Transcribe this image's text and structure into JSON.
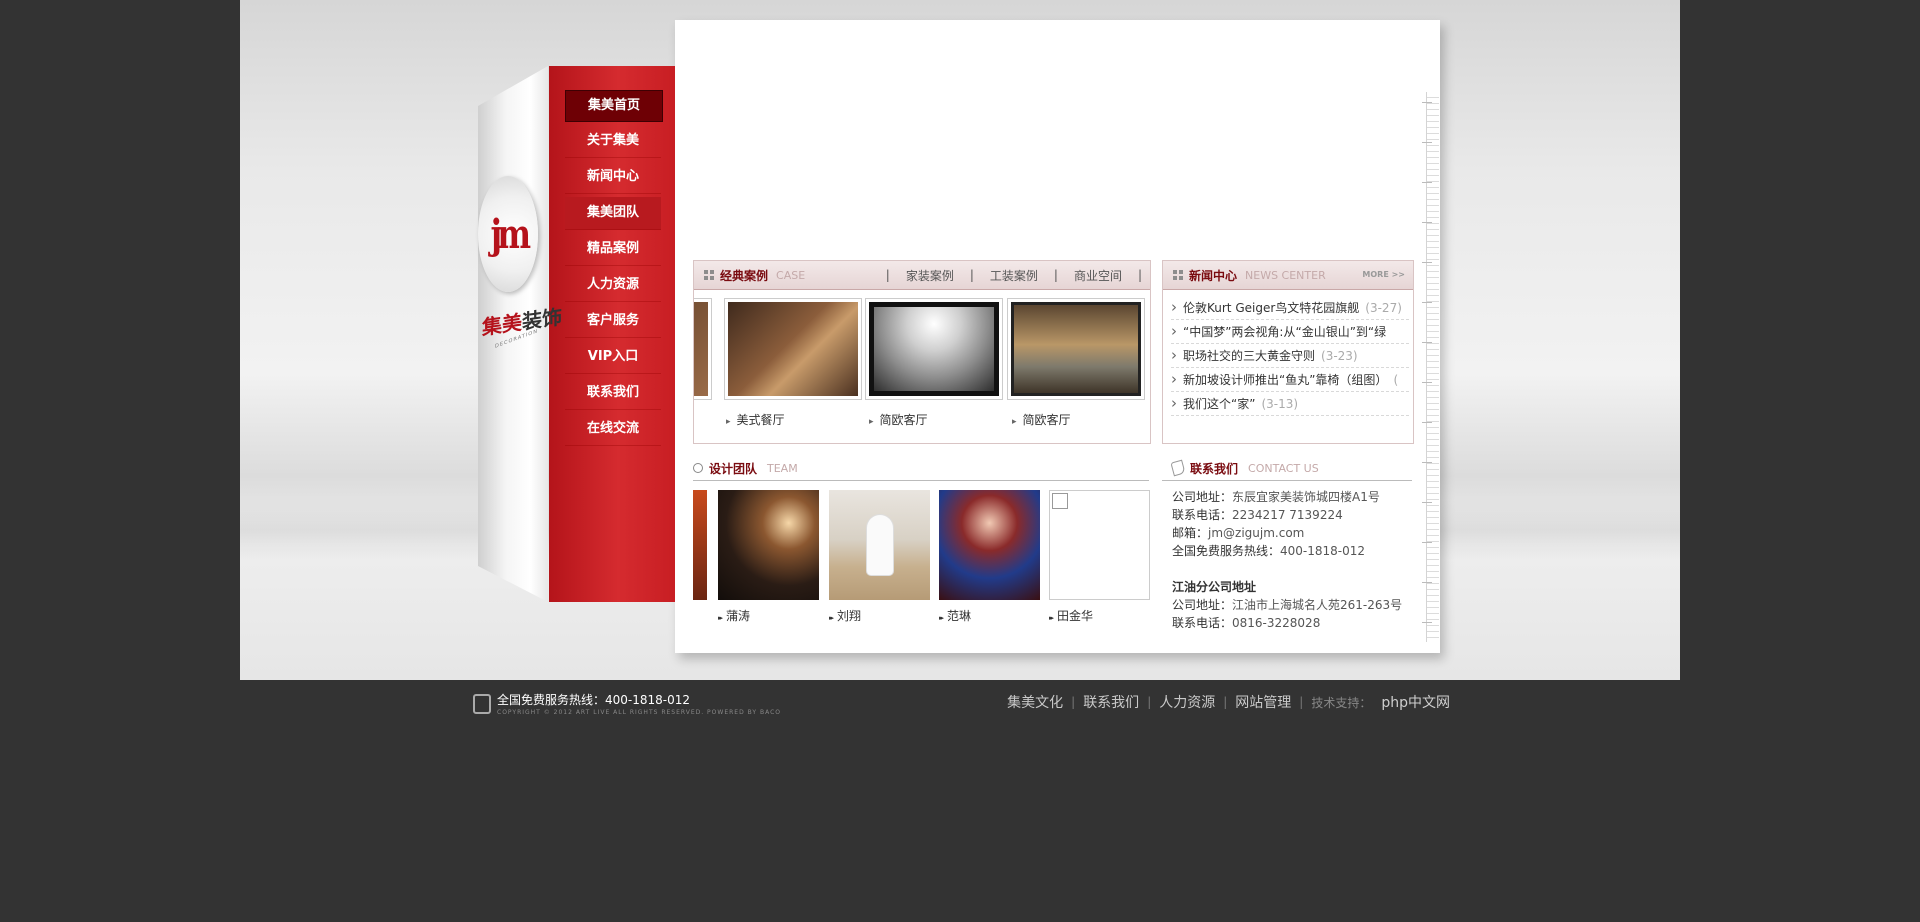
{
  "nav": {
    "items": [
      "集美首页",
      "关于集美",
      "新闻中心",
      "集美团队",
      "精品案例",
      "人力资源",
      "客户服务",
      "VIP入口",
      "联系我们",
      "在线交流"
    ]
  },
  "brand": {
    "logo_mark": "jm",
    "name_part1": "集美",
    "name_part2": "装饰",
    "sub": "DECORATION"
  },
  "cases": {
    "title": "经典案例",
    "title_en": "CASE",
    "tabs": [
      "家装案例",
      "工装案例",
      "商业空间"
    ],
    "sep": "|",
    "captions": [
      "美式餐厅",
      "简欧客厅",
      "简欧客厅"
    ]
  },
  "news": {
    "title": "新闻中心",
    "title_en": "NEWS CENTER",
    "more": "MORE >>",
    "items": [
      {
        "title": "伦敦Kurt Geiger鸟文特花园旗舰",
        "date": "(3-27)"
      },
      {
        "title": "“中国梦”两会视角:从“金山银山”到“绿",
        "date": ""
      },
      {
        "title": "职场社交的三大黄金守则",
        "date": "(3-23)"
      },
      {
        "title": "新加坡设计师推出“鱼丸”靠椅（组图）",
        "date": "("
      },
      {
        "title": "我们这个“家”",
        "date": "(3-13)"
      }
    ]
  },
  "team": {
    "title": "设计团队",
    "title_en": "TEAM",
    "members": [
      "蒲涛",
      "刘翔",
      "范琳",
      "田金华"
    ]
  },
  "contact": {
    "title": "联系我们",
    "title_en": "CONTACT US",
    "lines": [
      {
        "label": "公司地址：",
        "value": "东辰宜家美装饰城四楼A1号"
      },
      {
        "label": "联系电话：",
        "value": "2234217  7139224"
      },
      {
        "label": "邮箱：",
        "value": "jm@zigujm.com"
      },
      {
        "label": "全国免费服务热线：",
        "value": "400-1818-012"
      }
    ],
    "branch_title": "江油分公司地址",
    "branch_lines": [
      {
        "label": "公司地址：",
        "value": "江油市上海城名人苑261-263号"
      },
      {
        "label": "联系电话：",
        "value": "0816-3228028"
      }
    ]
  },
  "footer": {
    "hotline": "全国免费服务热线：400-1818-012",
    "copyright": "COPYRIGHT © 2012 ART LIVE ALL RIGHTS RESERVED. POWERED BY BACO",
    "links": [
      "集美文化",
      "联系我们",
      "人力资源",
      "网站管理"
    ],
    "sep": "|",
    "tech_label": "技术支持：",
    "tech_value": "php中文网"
  },
  "colors": {
    "nav_red": "#d52b2f",
    "nav_active": "#6e0005",
    "accent_dark_red": "#7a0b10",
    "page_bg": "#333333"
  }
}
